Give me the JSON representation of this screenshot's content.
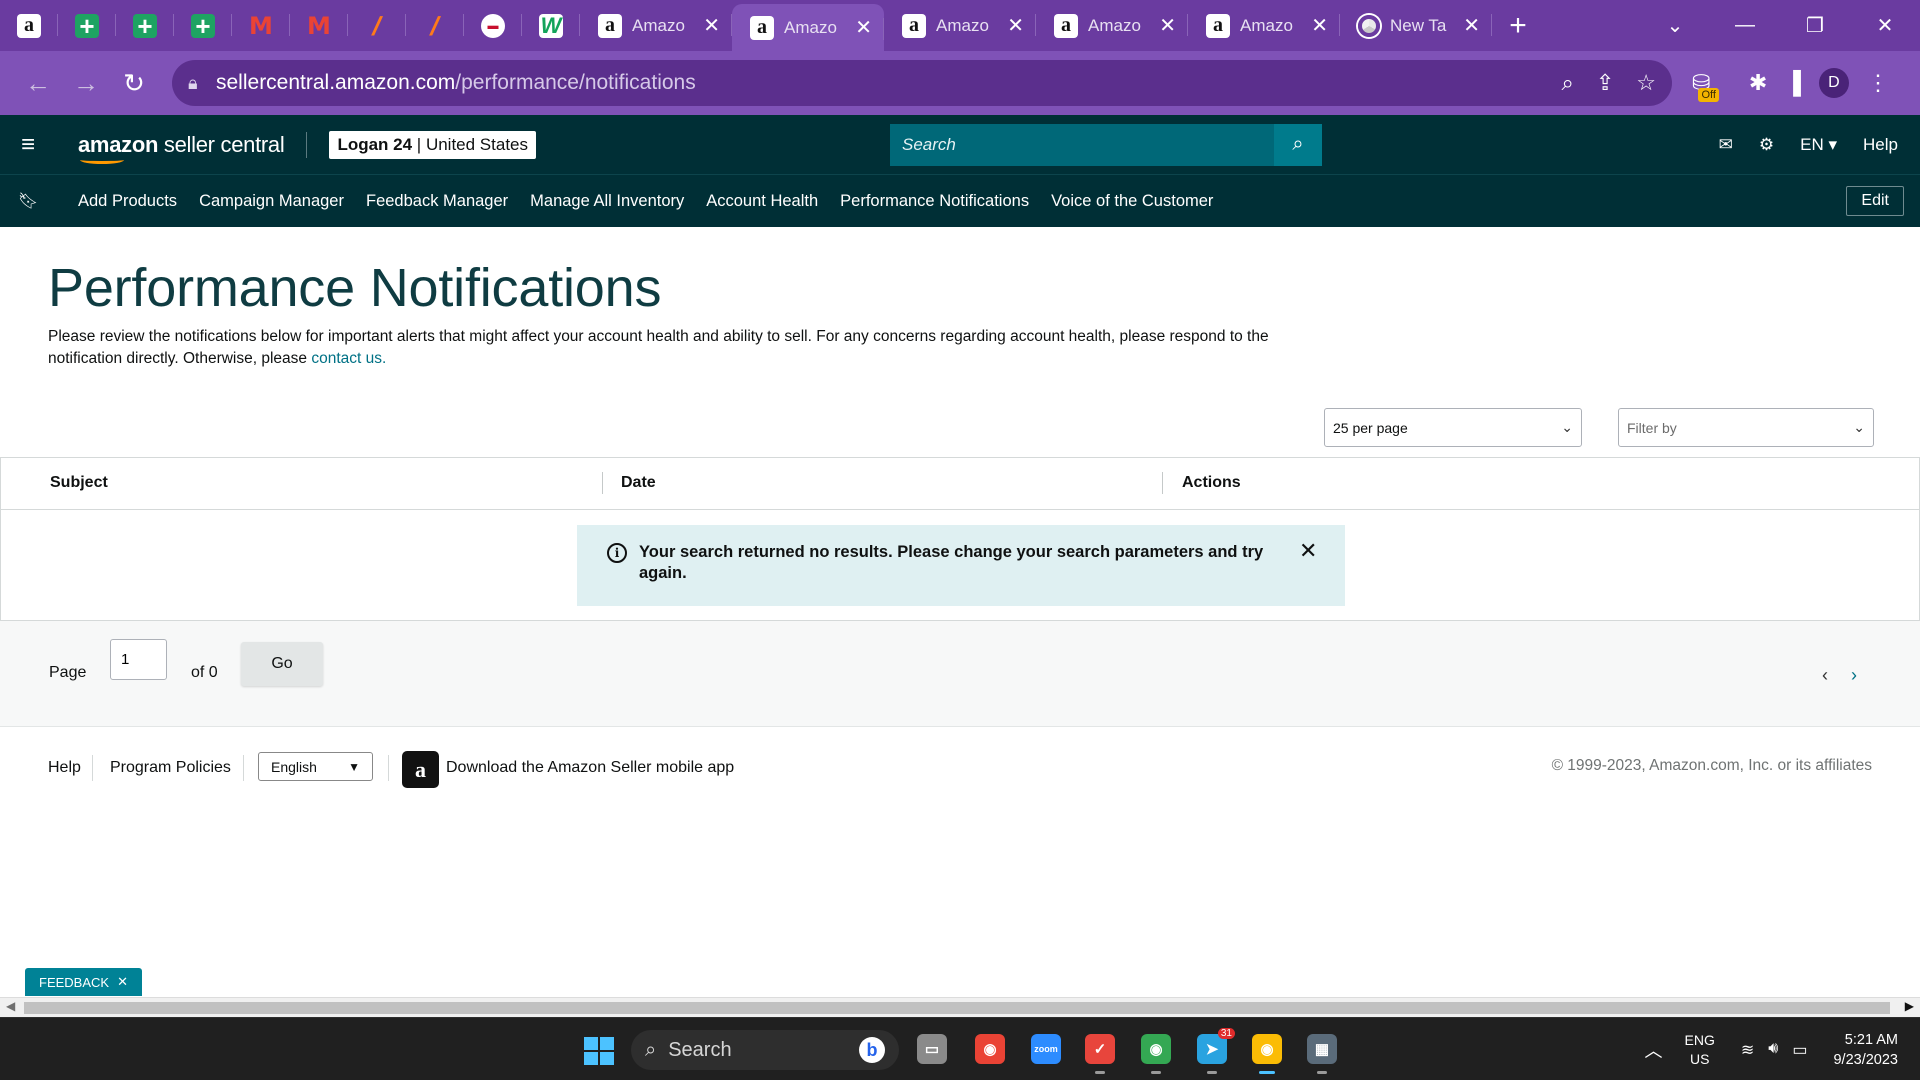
{
  "browser": {
    "pinned_tabs": [
      {
        "icon": "amazon-icon",
        "glyph": "a"
      },
      {
        "icon": "sheets-icon",
        "glyph": "+"
      },
      {
        "icon": "sheets-icon",
        "glyph": "+"
      },
      {
        "icon": "sheets-icon",
        "glyph": "+"
      },
      {
        "icon": "gmail-icon",
        "glyph": "M"
      },
      {
        "icon": "gmail-icon",
        "glyph": "M"
      },
      {
        "icon": "slash-app-icon",
        "glyph": "/"
      },
      {
        "icon": "slash-app-icon",
        "glyph": "/"
      },
      {
        "icon": "red-logo-icon",
        "glyph": "▬"
      },
      {
        "icon": "w-app-icon",
        "glyph": "W"
      }
    ],
    "tabs": [
      {
        "title": "Amazo",
        "icon": "amazon-icon",
        "active": false
      },
      {
        "title": "Amazo",
        "icon": "amazon-icon",
        "active": true
      },
      {
        "title": "Amazo",
        "icon": "amazon-icon",
        "active": false
      },
      {
        "title": "Amazo",
        "icon": "amazon-icon",
        "active": false
      },
      {
        "title": "Amazo",
        "icon": "amazon-icon",
        "active": false
      },
      {
        "title": "New Ta",
        "icon": "chrome-icon",
        "active": false
      }
    ],
    "url_host": "sellercentral.amazon.com",
    "url_path": "/performance/notifications",
    "extension_badge": "Off",
    "profile_initial": "D",
    "accent_color": "#6a3ba0"
  },
  "header": {
    "logo_brand": "amazon",
    "logo_product": " seller central",
    "account_name": "Logan 24",
    "account_marketplace": " | United States",
    "search_placeholder": "Search",
    "language": "EN",
    "help_label": "Help",
    "bg_color": "#002f36"
  },
  "nav": {
    "links": [
      "Add Products",
      "Campaign Manager",
      "Feedback Manager",
      "Manage All Inventory",
      "Account Health",
      "Performance Notifications",
      "Voice of the Customer"
    ],
    "edit_label": "Edit"
  },
  "page": {
    "title": "Performance Notifications",
    "description": "Please review the notifications below for important alerts that might affect your account health and ability to sell. For any concerns regarding account health, please respond to the notification directly. Otherwise, please ",
    "contact_link": "contact us.",
    "per_page_value": "25 per page",
    "filter_placeholder": "Filter by"
  },
  "table": {
    "columns": [
      "Subject",
      "Date",
      "Actions"
    ],
    "rows": [],
    "empty_message": "Your search returned no results. Please change your search parameters and try again."
  },
  "pagination": {
    "page_label": "Page",
    "current_page": "1",
    "of_label": "of 0",
    "go_label": "Go"
  },
  "footer": {
    "help": "Help",
    "policies": "Program Policies",
    "language_value": "English",
    "app_text": "Download the Amazon Seller mobile app",
    "copyright": "© 1999-2023, Amazon.com, Inc. or its affiliates"
  },
  "feedback_label": "FEEDBACK",
  "taskbar": {
    "search_label": "Search",
    "apps": [
      {
        "name": "file-explorer-icon",
        "color": "#8a8a8a",
        "glyph": "▭"
      },
      {
        "name": "chrome-icon",
        "color": "#ea4335",
        "glyph": "◉"
      },
      {
        "name": "zoom-icon",
        "color": "#2d8cff",
        "glyph": "zoom"
      },
      {
        "name": "tick-app-icon",
        "color": "#e8453c",
        "glyph": "✓"
      },
      {
        "name": "chrome-profile-icon",
        "color": "#34a853",
        "glyph": "◉"
      },
      {
        "name": "telegram-icon",
        "color": "#2aa3e0",
        "glyph": "➤",
        "badge": "31"
      },
      {
        "name": "chrome-active-icon",
        "color": "#fbbc05",
        "glyph": "◉"
      },
      {
        "name": "calculator-icon",
        "color": "#5a6b7a",
        "glyph": "▦"
      }
    ],
    "lang_line1": "ENG",
    "lang_line2": "US",
    "time": "5:21 AM",
    "date": "9/23/2023"
  }
}
